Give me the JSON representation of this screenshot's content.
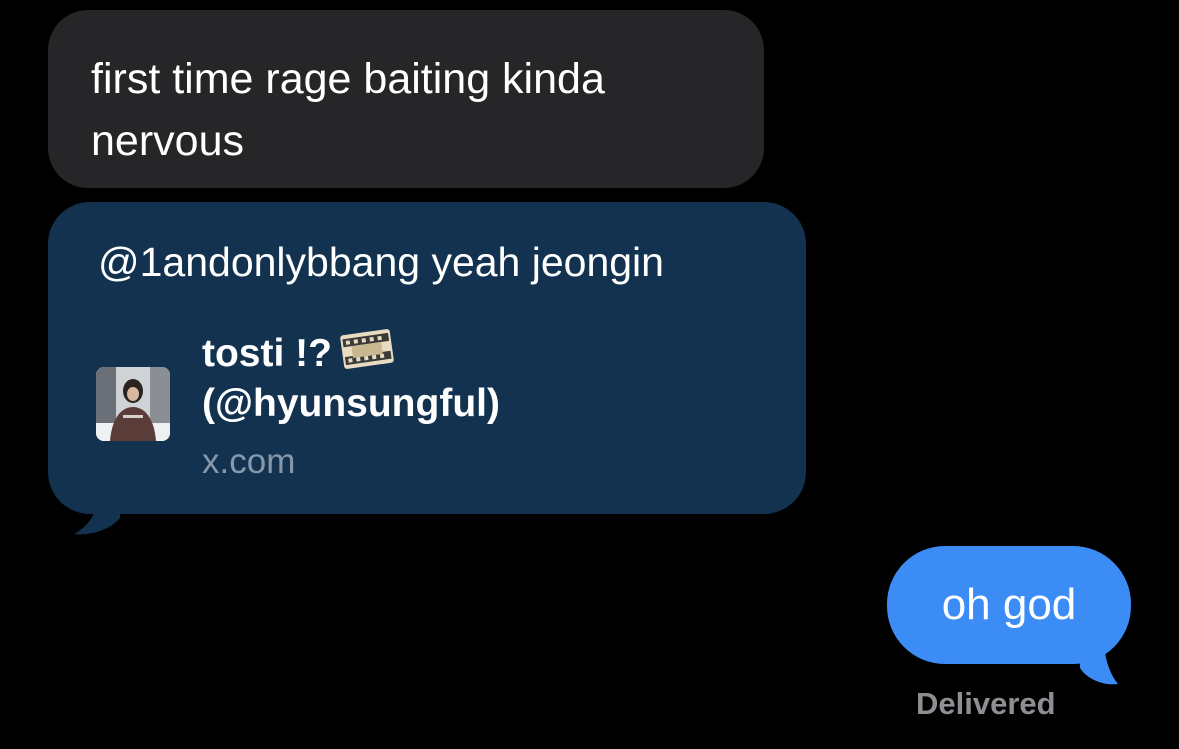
{
  "messages": [
    {
      "direction": "incoming",
      "text_line1": "first time rage baiting kinda",
      "text_line2": "nervous"
    },
    {
      "direction": "incoming",
      "text": "@1andonlybbang yeah jeongin",
      "link_preview": {
        "title_line1": "tosti !?",
        "title_line2": "(@hyunsungful)",
        "domain": "x.com",
        "emoji": "film-frames-icon"
      }
    },
    {
      "direction": "outgoing",
      "text": "oh god"
    }
  ],
  "status": "Delivered",
  "colors": {
    "background": "#000000",
    "incoming_bubble": "#262629",
    "link_bubble": "#12324f",
    "outgoing_bubble": "#3b8cf5",
    "status_text": "#8e8e93",
    "domain_text": "#8798ab"
  }
}
